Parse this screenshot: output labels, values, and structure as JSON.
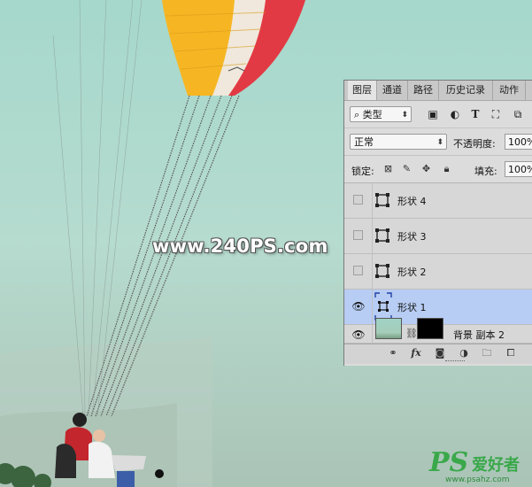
{
  "watermark": "www.240PS.com",
  "logo": {
    "ps": "PS",
    "cn": "爱好者",
    "url": "www.psahz.com"
  },
  "panel": {
    "tabs": [
      "图层",
      "通道",
      "路径",
      "历史记录",
      "动作"
    ],
    "filter": {
      "icon": "search-icon",
      "label": "类型"
    },
    "filter_icons": [
      "image-filter-icon",
      "adjustment-filter-icon",
      "type-filter-icon",
      "shape-filter-icon",
      "smart-object-filter-icon"
    ],
    "type_glyph": "T",
    "blend_mode": "正常",
    "opacity_label": "不透明度:",
    "opacity_value": "100%",
    "lock_label": "锁定:",
    "fill_label": "填充:",
    "fill_value": "100%",
    "layers": [
      {
        "name": "形状 4",
        "visible": false,
        "selected": false,
        "kind": "shape"
      },
      {
        "name": "形状 3",
        "visible": false,
        "selected": false,
        "kind": "shape"
      },
      {
        "name": "形状 2",
        "visible": false,
        "selected": false,
        "kind": "shape"
      },
      {
        "name": "形状 1",
        "visible": true,
        "selected": true,
        "kind": "shape"
      },
      {
        "name": "背景 副本 2",
        "visible": true,
        "selected": false,
        "kind": "image"
      }
    ],
    "footer_icons": [
      "link-icon",
      "fx-icon",
      "mask-icon",
      "adjustment-icon",
      "folder-icon",
      "new-layer-icon"
    ],
    "fx_label": "fx",
    "colors": {
      "selected_row": "#b8cdf4",
      "panel_bg": "#dcdcdc"
    }
  },
  "scene": {
    "canopy_colors": [
      "#f6b624",
      "#f0e8dc",
      "#e23a44"
    ]
  }
}
